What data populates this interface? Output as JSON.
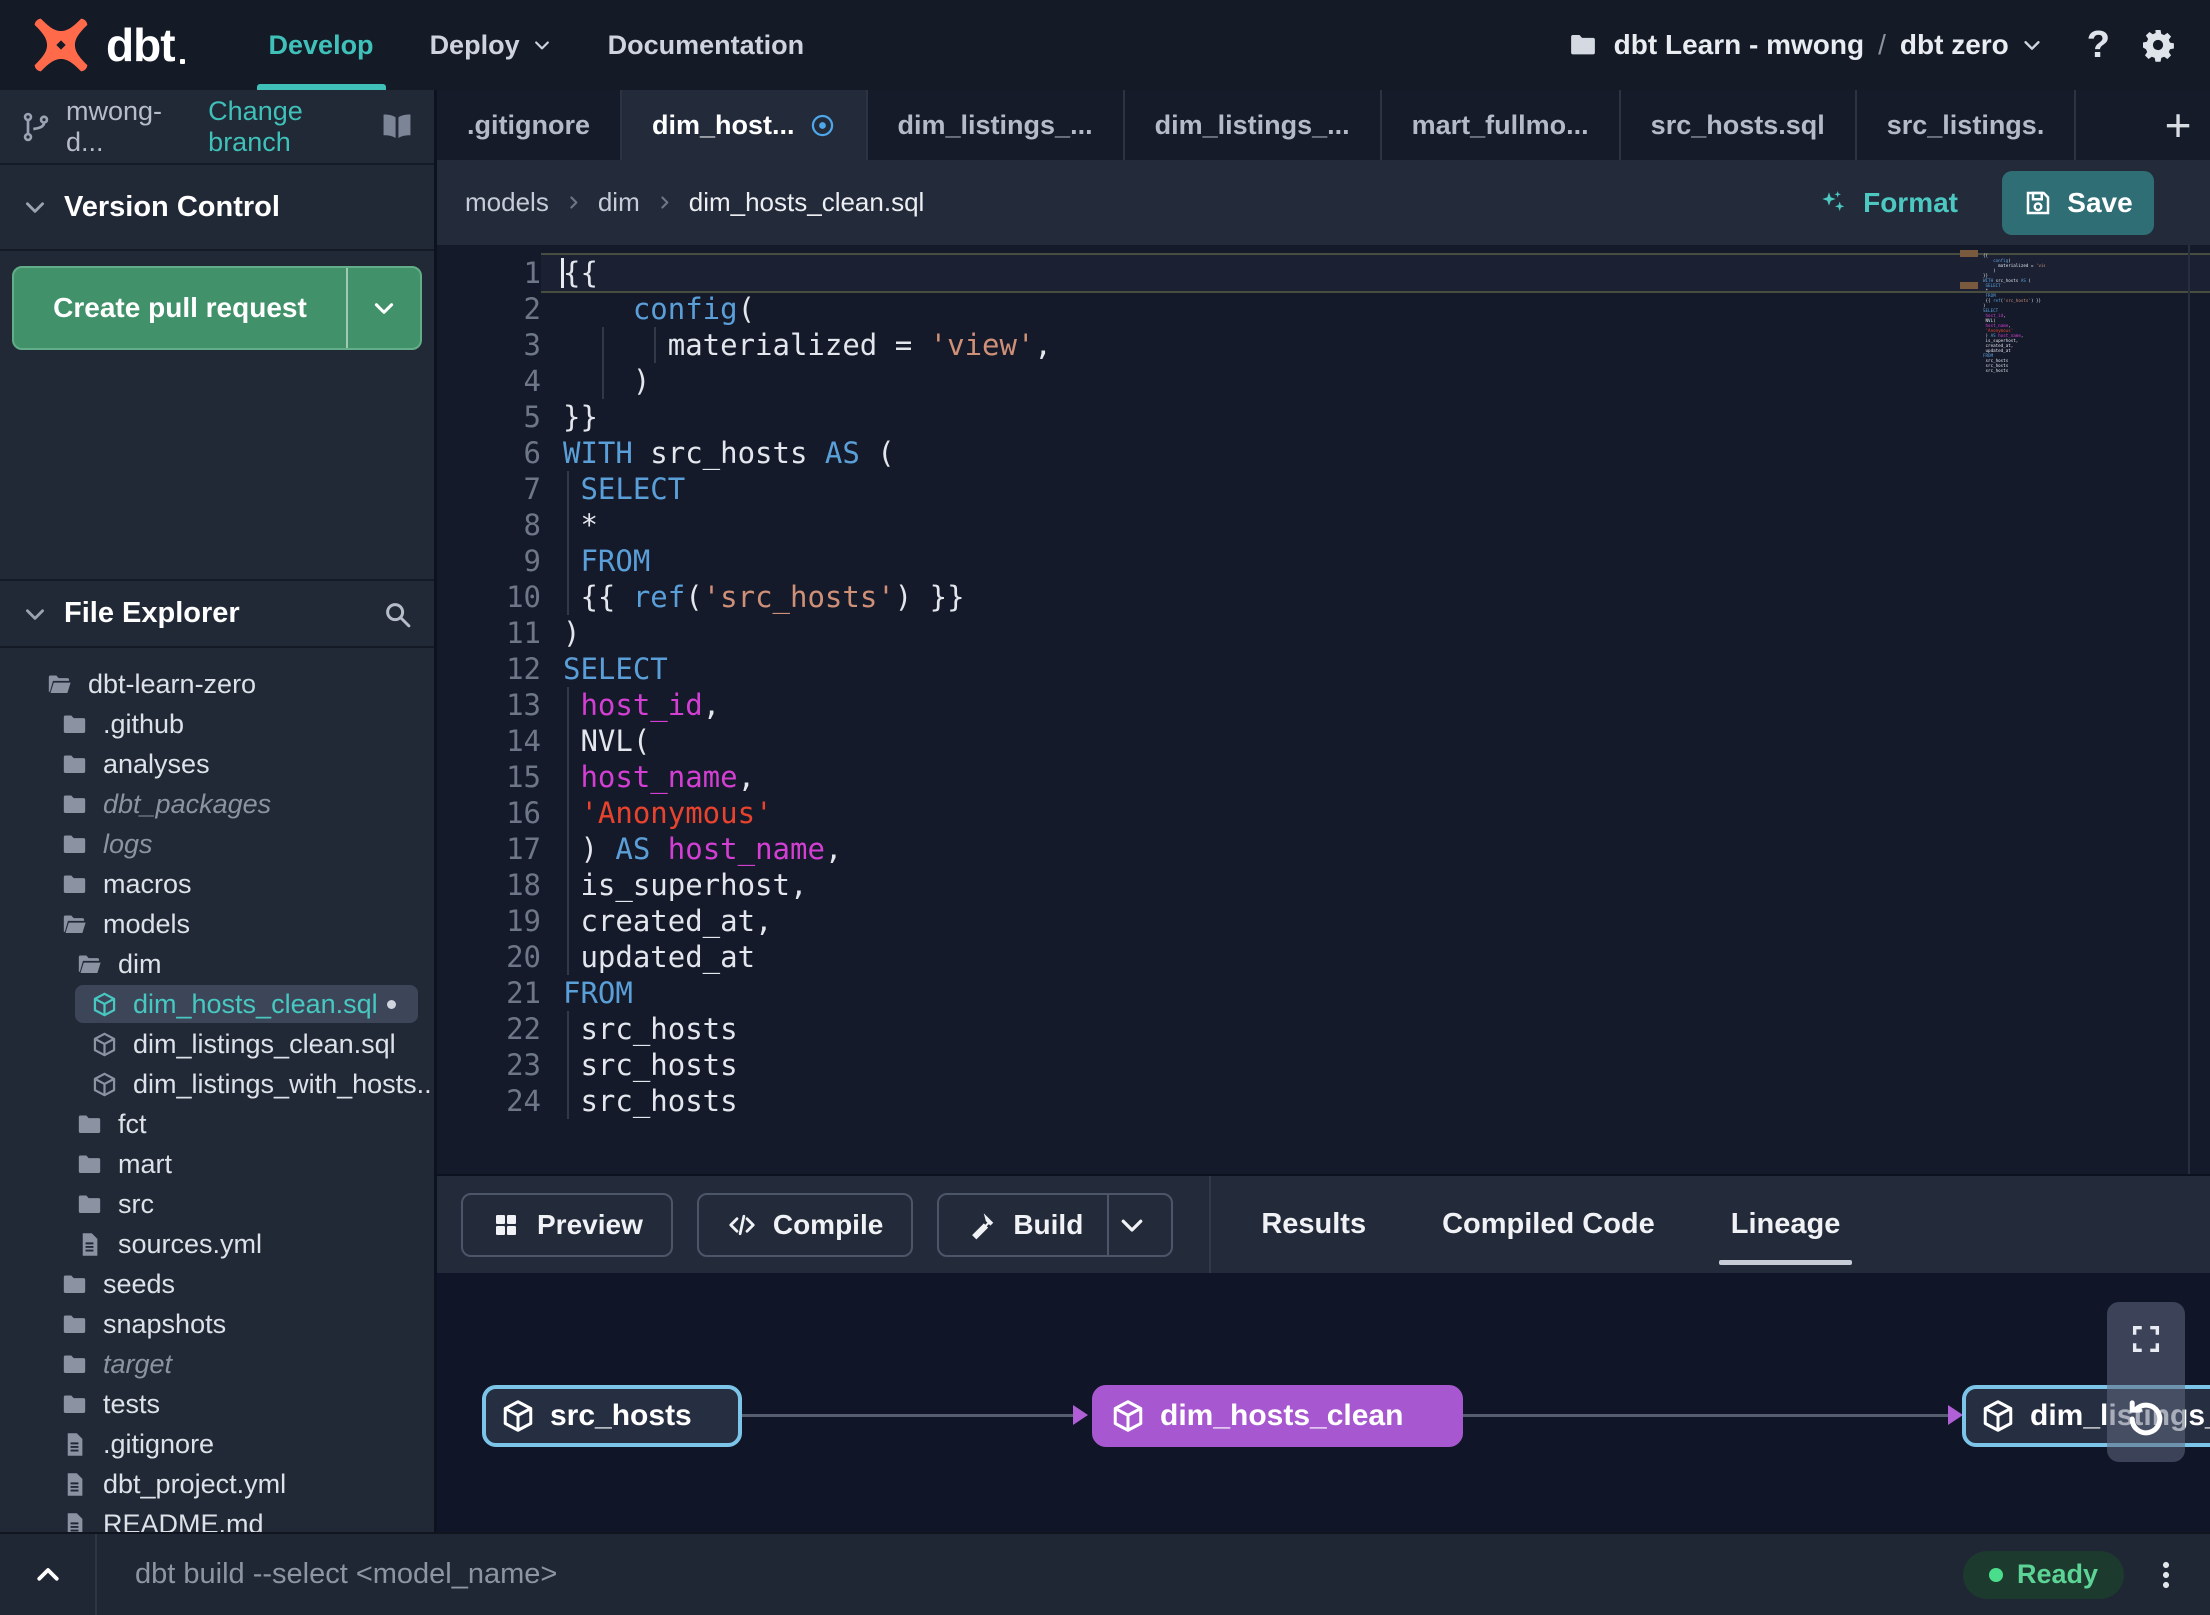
{
  "theme": {
    "accent_teal": "#3FC0B8",
    "save_button_teal": "#2E6E74",
    "create_pr_green": "#41926A",
    "status_green": "#4ADE8C",
    "lineage_purple": "#A757CF",
    "lineage_cyan_border": "#7CC5E8",
    "tab_modified_blue": "#4DA7E8",
    "code_keyword_blue": "#5B9FD8",
    "code_string_salmon": "#CF9078",
    "code_string_red": "#E8432D",
    "code_column_magenta": "#D33FD3",
    "logo_orange": "#FF6A4B"
  },
  "topnav": {
    "brand": "dbt",
    "menus": [
      {
        "label": "Develop",
        "active": true
      },
      {
        "label": "Deploy",
        "chevron": true
      },
      {
        "label": "Documentation"
      }
    ],
    "project": {
      "icon": "folder-icon",
      "name": "dbt Learn - mwong",
      "separator": "/",
      "environment": "dbt zero"
    }
  },
  "sidebar": {
    "branch": {
      "name": "mwong-d...",
      "change_action": "Change branch"
    },
    "version_control": {
      "title": "Version Control",
      "create_pr_label": "Create pull request"
    },
    "file_explorer": {
      "title": "File Explorer",
      "tree": [
        {
          "label": "dbt-learn-zero",
          "icon": "folder-open",
          "depth": 0
        },
        {
          "label": ".github",
          "icon": "folder",
          "depth": 1
        },
        {
          "label": "analyses",
          "icon": "folder",
          "depth": 1
        },
        {
          "label": "dbt_packages",
          "icon": "folder",
          "depth": 1,
          "muted": true
        },
        {
          "label": "logs",
          "icon": "folder",
          "depth": 1,
          "muted": true
        },
        {
          "label": "macros",
          "icon": "folder",
          "depth": 1
        },
        {
          "label": "models",
          "icon": "folder-open",
          "depth": 1
        },
        {
          "label": "dim",
          "icon": "folder-open",
          "depth": 2
        },
        {
          "label": "dim_hosts_clean.sql",
          "icon": "model",
          "depth": 3,
          "selected": true,
          "unsaved": true
        },
        {
          "label": "dim_listings_clean.sql",
          "icon": "model",
          "depth": 3
        },
        {
          "label": "dim_listings_with_hosts...",
          "icon": "model",
          "depth": 3
        },
        {
          "label": "fct",
          "icon": "folder",
          "depth": 2
        },
        {
          "label": "mart",
          "icon": "folder",
          "depth": 2
        },
        {
          "label": "src",
          "icon": "folder",
          "depth": 2
        },
        {
          "label": "sources.yml",
          "icon": "file",
          "depth": 2
        },
        {
          "label": "seeds",
          "icon": "folder",
          "depth": 1
        },
        {
          "label": "snapshots",
          "icon": "folder",
          "depth": 1
        },
        {
          "label": "target",
          "icon": "folder",
          "depth": 1,
          "muted": true
        },
        {
          "label": "tests",
          "icon": "folder",
          "depth": 1
        },
        {
          "label": ".gitignore",
          "icon": "file",
          "depth": 1
        },
        {
          "label": "dbt_project.yml",
          "icon": "file",
          "depth": 1
        },
        {
          "label": "README.md",
          "icon": "file",
          "depth": 1
        }
      ]
    }
  },
  "tab_bar": {
    "tabs": [
      {
        "label": ".gitignore"
      },
      {
        "label": "dim_host...",
        "active": true,
        "modified": true
      },
      {
        "label": "dim_listings_..."
      },
      {
        "label": "dim_listings_..."
      },
      {
        "label": "mart_fullmo..."
      },
      {
        "label": "src_hosts.sql"
      },
      {
        "label": "src_listings."
      }
    ],
    "new_tab_label": "+"
  },
  "breadcrumb": {
    "path": [
      "models",
      "dim",
      "dim_hosts_clean.sql"
    ]
  },
  "editor_actions": {
    "format_label": "Format",
    "save_label": "Save"
  },
  "editor": {
    "lines": [
      {
        "n": 1,
        "current": true,
        "tokens": [
          [
            "p",
            "{{"
          ]
        ]
      },
      {
        "n": 2,
        "tokens": [
          [
            "p",
            "    "
          ],
          [
            "k",
            "config"
          ],
          [
            "p",
            "("
          ]
        ]
      },
      {
        "n": 3,
        "guides": [
          2,
          5
        ],
        "tokens": [
          [
            "p",
            "      materialized = "
          ],
          [
            "s",
            "'view'"
          ],
          [
            "p",
            ","
          ]
        ]
      },
      {
        "n": 4,
        "guides": [
          2
        ],
        "tokens": [
          [
            "p",
            "    )"
          ]
        ]
      },
      {
        "n": 5,
        "tokens": [
          [
            "p",
            "}}"
          ]
        ]
      },
      {
        "n": 6,
        "tokens": [
          [
            "k",
            "WITH"
          ],
          [
            "p",
            " src_hosts "
          ],
          [
            "k",
            "AS"
          ],
          [
            "p",
            " ("
          ]
        ]
      },
      {
        "n": 7,
        "guides": [
          0
        ],
        "tokens": [
          [
            "p",
            " "
          ],
          [
            "k",
            "SELECT"
          ]
        ]
      },
      {
        "n": 8,
        "guides": [
          0
        ],
        "tokens": [
          [
            "p",
            " *"
          ]
        ]
      },
      {
        "n": 9,
        "guides": [
          0
        ],
        "tokens": [
          [
            "p",
            " "
          ],
          [
            "k",
            "FROM"
          ]
        ]
      },
      {
        "n": 10,
        "guides": [
          0
        ],
        "tokens": [
          [
            "p",
            " {{ "
          ],
          [
            "k",
            "ref"
          ],
          [
            "p",
            "("
          ],
          [
            "s",
            "'src_hosts'"
          ],
          [
            "p",
            ") }}"
          ]
        ]
      },
      {
        "n": 11,
        "tokens": [
          [
            "p",
            ")"
          ]
        ]
      },
      {
        "n": 12,
        "tokens": [
          [
            "k",
            "SELECT"
          ]
        ]
      },
      {
        "n": 13,
        "guides": [
          0
        ],
        "tokens": [
          [
            "p",
            " "
          ],
          [
            "m",
            "host_id"
          ],
          [
            "p",
            ","
          ]
        ]
      },
      {
        "n": 14,
        "guides": [
          0
        ],
        "tokens": [
          [
            "p",
            " NVL("
          ]
        ]
      },
      {
        "n": 15,
        "guides": [
          0
        ],
        "tokens": [
          [
            "p",
            " "
          ],
          [
            "m",
            "host_name"
          ],
          [
            "p",
            ","
          ]
        ]
      },
      {
        "n": 16,
        "guides": [
          0
        ],
        "tokens": [
          [
            "p",
            " "
          ],
          [
            "r",
            "'Anonymous'"
          ]
        ]
      },
      {
        "n": 17,
        "guides": [
          0
        ],
        "tokens": [
          [
            "p",
            " ) "
          ],
          [
            "k",
            "AS"
          ],
          [
            "p",
            " "
          ],
          [
            "m",
            "host_name"
          ],
          [
            "p",
            ","
          ]
        ]
      },
      {
        "n": 18,
        "guides": [
          0
        ],
        "tokens": [
          [
            "p",
            " is_superhost,"
          ]
        ]
      },
      {
        "n": 19,
        "guides": [
          0
        ],
        "tokens": [
          [
            "p",
            " created_at,"
          ]
        ]
      },
      {
        "n": 20,
        "guides": [
          0
        ],
        "tokens": [
          [
            "p",
            " updated_at"
          ]
        ]
      },
      {
        "n": 21,
        "tokens": [
          [
            "k",
            "FROM"
          ]
        ]
      },
      {
        "n": 22,
        "guides": [
          0
        ],
        "tokens": [
          [
            "p",
            " src_hosts"
          ]
        ]
      },
      {
        "n": 23,
        "guides": [
          0
        ],
        "tokens": [
          [
            "p",
            " src_hosts"
          ]
        ]
      },
      {
        "n": 24,
        "guides": [
          0
        ],
        "tokens": [
          [
            "p",
            " src_hosts"
          ]
        ]
      }
    ]
  },
  "bottom_panel": {
    "buttons": [
      {
        "label": "Preview",
        "icon": "grid-icon"
      },
      {
        "label": "Compile",
        "icon": "code-icon"
      },
      {
        "label": "Build",
        "icon": "hammer-icon",
        "split": true
      }
    ],
    "tabs": [
      {
        "label": "Results"
      },
      {
        "label": "Compiled Code"
      },
      {
        "label": "Lineage",
        "active": true
      }
    ]
  },
  "lineage": {
    "nodes": [
      {
        "label": "src_hosts",
        "style": "cyan"
      },
      {
        "label": "dim_hosts_clean",
        "style": "purple"
      },
      {
        "label": "dim_listings_with_hosts",
        "style": "cyan"
      }
    ]
  },
  "statusbar": {
    "command_placeholder": "dbt build --select <model_name>",
    "status_label": "Ready"
  }
}
